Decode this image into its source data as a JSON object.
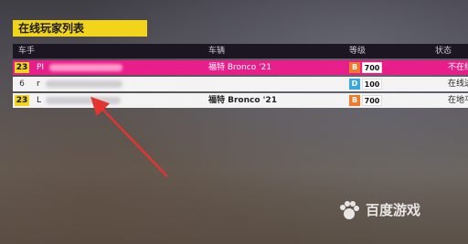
{
  "panel": {
    "title": "在线玩家列表"
  },
  "columns": {
    "driver": "车手",
    "vehicle": "车辆",
    "rank": "等级",
    "status": "状态"
  },
  "rows": [
    {
      "level": "23",
      "name": "PI",
      "vehicle": "福特 Bronco '21",
      "class": "B",
      "class_color": "#ef7a2a",
      "score": "700",
      "status": "不在线",
      "highlight": true
    },
    {
      "level": "6",
      "name": "r",
      "vehicle": "",
      "class": "D",
      "class_color": "#3aa7e0",
      "score": "100",
      "status": "在线进行",
      "highlight": false
    },
    {
      "level": "23",
      "name": "L",
      "vehicle": "福特 Bronco '21",
      "class": "B",
      "class_color": "#ef7a2a",
      "score": "700",
      "status": "在地平线",
      "highlight": false
    }
  ],
  "watermark": {
    "text": "百度游戏",
    "icon": "baidu-paw-icon"
  },
  "colors": {
    "accent_yellow": "#f2d41a",
    "highlight_pink": "#e81e8a",
    "arrow_red": "#e3342f"
  }
}
